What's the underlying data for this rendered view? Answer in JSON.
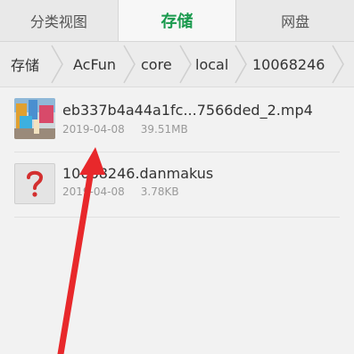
{
  "tabs": [
    {
      "label": "分类视图"
    },
    {
      "label": "存储"
    },
    {
      "label": "网盘"
    }
  ],
  "breadcrumb": [
    {
      "label": "存储"
    },
    {
      "label": "AcFun"
    },
    {
      "label": "core"
    },
    {
      "label": "local"
    },
    {
      "label": "10068246"
    }
  ],
  "files": [
    {
      "name": "eb337b4a44a1fc...7566ded_2.mp4",
      "date": "2019-04-08",
      "size": "39.51MB",
      "icon": "video-thumbnail-icon"
    },
    {
      "name": "10068246.danmakus",
      "date": "2019-04-08",
      "size": "3.78KB",
      "icon": "unknown-file-icon"
    }
  ],
  "colors": {
    "accent": "#1a9a4e",
    "annotation": "#e8282b"
  }
}
